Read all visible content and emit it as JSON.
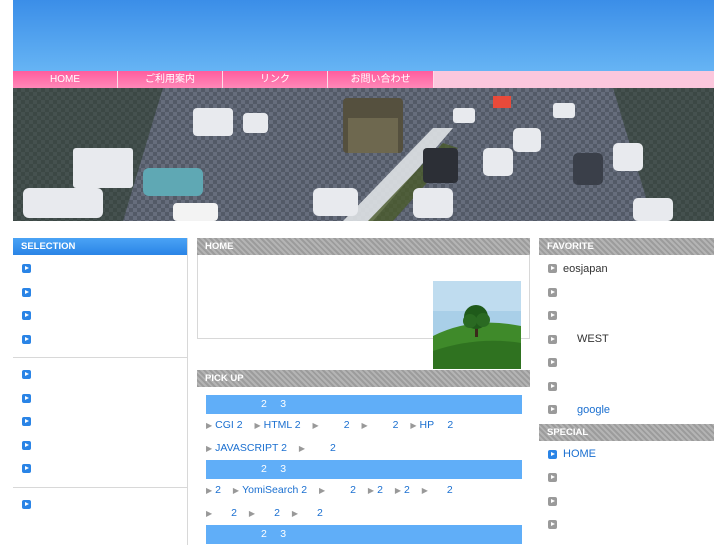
{
  "nav": {
    "items": [
      "HOME",
      "ご利用案内",
      "リンク",
      "お問い合わせ"
    ]
  },
  "left": {
    "title": "SELECTION"
  },
  "main": {
    "home_title": "HOME",
    "pickup_title": "PICK UP",
    "pickup_groups": [
      {
        "bar": "2　 3",
        "rows": [
          [
            {
              "t": "CGI 2"
            },
            {
              "t": "HTML 2"
            },
            {
              "t": "2"
            },
            {
              "t": "2"
            },
            {
              "t": "HP　 2"
            }
          ],
          [
            {
              "t": "JAVASCRIPT 2"
            },
            {
              "t": "2"
            }
          ]
        ]
      },
      {
        "bar": "2　 3",
        "rows": [
          [
            {
              "t": "2"
            },
            {
              "t": "YomiSearch 2"
            },
            {
              "t": "2"
            },
            {
              "t": "2"
            },
            {
              "t": "2"
            },
            {
              "t": "2"
            }
          ],
          [
            {
              "t": "2"
            },
            {
              "t": "2"
            },
            {
              "t": "2"
            }
          ]
        ]
      },
      {
        "bar": "2　 3",
        "rows": []
      }
    ]
  },
  "right": {
    "favorite_title": "FAVORITE",
    "favorite_items": [
      "eosjapan",
      "",
      "",
      "WEST",
      "",
      "",
      "google"
    ],
    "special_title": "SPECIAL",
    "special_items": [
      "HOME",
      "",
      "",
      ""
    ]
  },
  "colors": {
    "header_blue": "#3b8ee8",
    "nav_pink": "#ff5d9e",
    "link_blue": "#1a6fd0",
    "bar_blue": "#60aef8"
  }
}
